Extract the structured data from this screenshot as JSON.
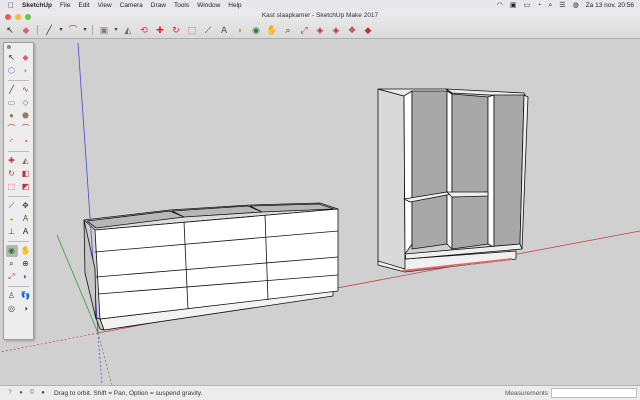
{
  "menubar": {
    "apple_icon": "apple-icon",
    "app_name": "SketchUp",
    "items": [
      "File",
      "Edit",
      "View",
      "Camera",
      "Draw",
      "Tools",
      "Window",
      "Help"
    ],
    "status": {
      "icons": [
        "wifi-like-icon",
        "box-icon",
        "battery-icon",
        "wifi-icon",
        "search-icon",
        "control-center-icon",
        "siri-icon"
      ],
      "datetime": "Za 13 nov.  20:56"
    }
  },
  "window": {
    "title": "Kast slaapkamer - SketchUp Make 2017",
    "traffic_colors": [
      "#ee5b55",
      "#f5bd2f",
      "#5ec840"
    ]
  },
  "toolbar": {
    "tools": [
      {
        "name": "select-icon",
        "glyph": "↖",
        "color": "#222"
      },
      {
        "name": "eraser-icon",
        "glyph": "◆",
        "color": "#d9607a"
      },
      {
        "name": "sep"
      },
      {
        "name": "line-icon",
        "glyph": "╱",
        "color": "#333"
      },
      {
        "name": "line-dropdown-icon",
        "glyph": "▾",
        "color": "#333"
      },
      {
        "name": "arc-icon",
        "glyph": "⌒",
        "color": "#c43a3a"
      },
      {
        "name": "arc-dropdown-icon",
        "glyph": "▾",
        "color": "#333"
      },
      {
        "name": "sep"
      },
      {
        "name": "shape-icon",
        "glyph": "▣",
        "color": "#8a7b6b"
      },
      {
        "name": "shape-dropdown-icon",
        "glyph": "▾",
        "color": "#333"
      },
      {
        "name": "push-pull-icon",
        "glyph": "◭",
        "color": "#7a6a5c"
      },
      {
        "name": "offset-icon",
        "glyph": "⟲",
        "color": "#d03030"
      },
      {
        "name": "move-icon",
        "glyph": "✚",
        "color": "#d03030"
      },
      {
        "name": "rotate-icon",
        "glyph": "↻",
        "color": "#d03030"
      },
      {
        "name": "scale-icon",
        "glyph": "⬚",
        "color": "#d03030"
      },
      {
        "name": "tape-measure-icon",
        "glyph": "⟋",
        "color": "#444"
      },
      {
        "name": "text-icon",
        "glyph": "A",
        "color": "#2a6a2a"
      },
      {
        "name": "paint-bucket-icon",
        "glyph": "◗",
        "color": "#caa020"
      },
      {
        "name": "orbit-icon",
        "glyph": "◉",
        "color": "#2b7a3b"
      },
      {
        "name": "pan-icon",
        "glyph": "✋",
        "color": "#444"
      },
      {
        "name": "zoom-icon",
        "glyph": "⌕",
        "color": "#333"
      },
      {
        "name": "zoom-extents-icon",
        "glyph": "⤢",
        "color": "#c03030"
      },
      {
        "name": "warehouse-icon",
        "glyph": "◈",
        "color": "#c03030"
      },
      {
        "name": "share-model-icon",
        "glyph": "◈",
        "color": "#c03030"
      },
      {
        "name": "extension-warehouse-icon",
        "glyph": "❖",
        "color": "#c03030"
      },
      {
        "name": "layout-icon",
        "glyph": "◆",
        "color": "#c03030"
      }
    ]
  },
  "palette": {
    "rows": [
      [
        {
          "n": "select-icon",
          "g": "↖",
          "c": "#222"
        },
        {
          "n": "eraser-icon",
          "g": "◆",
          "c": "#d9607a"
        }
      ],
      [
        {
          "n": "make-component-icon",
          "g": "⬡",
          "c": "#4a70c0"
        },
        {
          "n": "paint-bucket-icon",
          "g": "◗",
          "c": "#c99b20"
        }
      ],
      "sep",
      [
        {
          "n": "line-icon",
          "g": "╱",
          "c": "#333"
        },
        {
          "n": "freehand-icon",
          "g": "∿",
          "c": "#c03030"
        }
      ],
      [
        {
          "n": "rectangle-icon",
          "g": "▭",
          "c": "#8a6a50"
        },
        {
          "n": "rotated-rectangle-icon",
          "g": "◇",
          "c": "#8a6a50"
        }
      ],
      [
        {
          "n": "circle-icon",
          "g": "●",
          "c": "#9a7a60"
        },
        {
          "n": "polygon-icon",
          "g": "⬣",
          "c": "#9a7a60"
        }
      ],
      [
        {
          "n": "arc-icon",
          "g": "⌒",
          "c": "#c03030"
        },
        {
          "n": "two-point-arc-icon",
          "g": "⌒",
          "c": "#c03030"
        }
      ],
      [
        {
          "n": "three-point-arc-icon",
          "g": "◜",
          "c": "#c03030"
        },
        {
          "n": "pie-icon",
          "g": "◔",
          "c": "#c03030"
        }
      ],
      "sep",
      [
        {
          "n": "move-icon",
          "g": "✚",
          "c": "#d03030"
        },
        {
          "n": "push-pull-icon",
          "g": "◭",
          "c": "#8a6a50"
        }
      ],
      [
        {
          "n": "rotate-icon",
          "g": "↻",
          "c": "#d03030"
        },
        {
          "n": "follow-me-icon",
          "g": "◧",
          "c": "#c03030"
        }
      ],
      [
        {
          "n": "scale-icon",
          "g": "⬚",
          "c": "#d03030"
        },
        {
          "n": "offset-icon",
          "g": "◩",
          "c": "#c03030"
        }
      ],
      "sep",
      [
        {
          "n": "tape-measure-icon",
          "g": "⟋",
          "c": "#444"
        },
        {
          "n": "dimension-icon",
          "g": "✥",
          "c": "#444"
        }
      ],
      [
        {
          "n": "protractor-icon",
          "g": "◒",
          "c": "#caa020"
        },
        {
          "n": "text-icon",
          "g": "A",
          "c": "#2a6a2a"
        }
      ],
      [
        {
          "n": "axes-icon",
          "g": "⊥",
          "c": "#444"
        },
        {
          "n": "3d-text-icon",
          "g": "A",
          "c": "#222"
        }
      ],
      "sep",
      [
        {
          "n": "orbit-icon",
          "g": "◉",
          "c": "#2b7a3b",
          "active": true
        },
        {
          "n": "pan-icon",
          "g": "✋",
          "c": "#444"
        }
      ],
      [
        {
          "n": "zoom-icon",
          "g": "⌕",
          "c": "#333"
        },
        {
          "n": "zoom-window-icon",
          "g": "⊕",
          "c": "#333"
        }
      ],
      [
        {
          "n": "zoom-extents-icon",
          "g": "⤢",
          "c": "#c03030"
        },
        {
          "n": "previous-view-icon",
          "g": "◐",
          "c": "#2a60b0"
        }
      ],
      "sep",
      [
        {
          "n": "position-camera-icon",
          "g": "♙",
          "c": "#444"
        },
        {
          "n": "walk-icon",
          "g": "👣",
          "c": "#444"
        }
      ],
      [
        {
          "n": "look-around-icon",
          "g": "◎",
          "c": "#444"
        },
        {
          "n": "section-plane-icon",
          "g": "◑",
          "c": "#444"
        }
      ]
    ]
  },
  "status": {
    "icons": [
      {
        "name": "info-icon",
        "glyph": "?",
        "color": "#3a6ec0"
      },
      {
        "name": "geo-location-icon",
        "glyph": "●",
        "color": "#666"
      },
      {
        "name": "credits-icon",
        "glyph": "©",
        "color": "#666"
      },
      {
        "name": "user-icon",
        "glyph": "●",
        "color": "#2a4a90"
      }
    ],
    "text": "Drag to orbit. Shift = Pan, Option = suspend gravity.",
    "measurements_label": "Measurements",
    "measurements_value": ""
  },
  "scene": {
    "colors": {
      "background": "#d0d0d0",
      "face_front": "#ffffff",
      "face_shade": "#e9e9e9",
      "face_inner": "#a9a9a9",
      "edge": "#111111",
      "axis_red": "#c84040",
      "axis_green": "#3a9a3a",
      "axis_blue": "#4a4ad0"
    }
  }
}
